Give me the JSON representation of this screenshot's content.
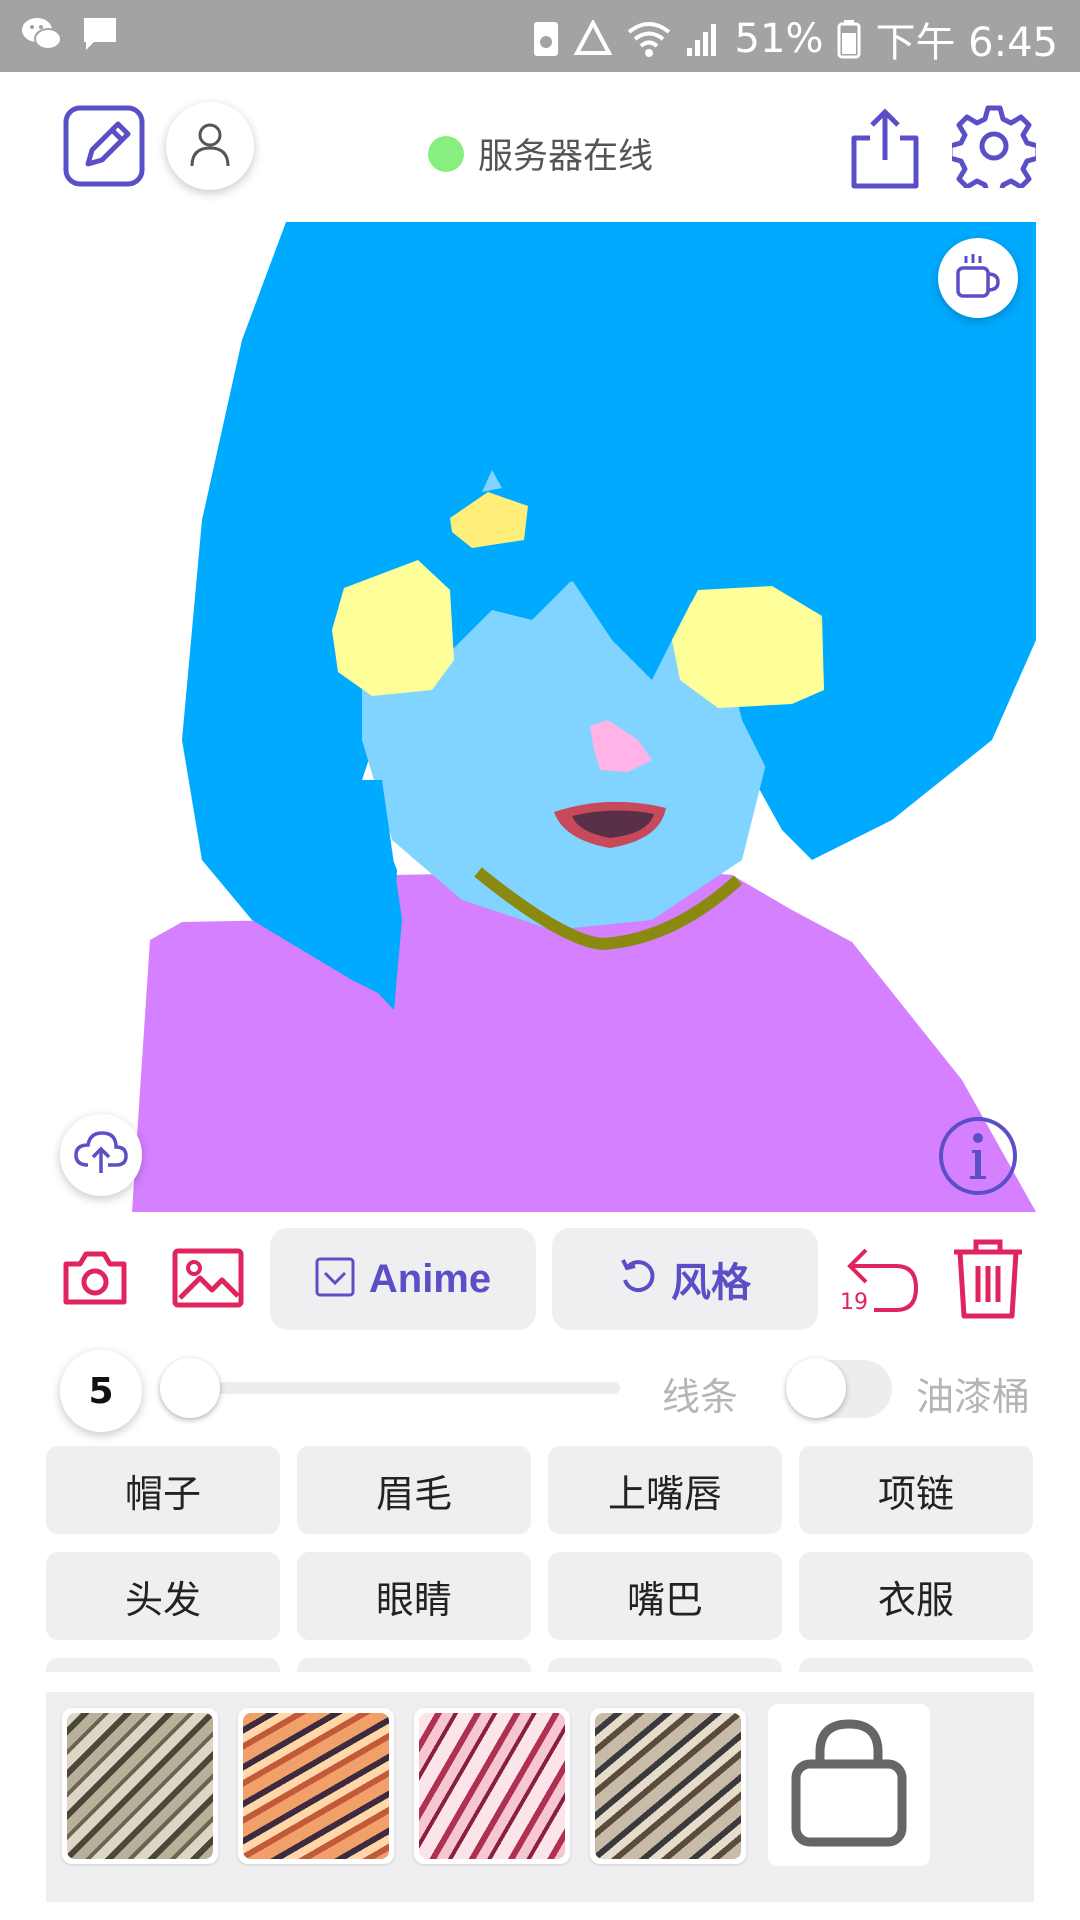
{
  "status_bar": {
    "battery": "51%",
    "time": "下午 6:45"
  },
  "header": {
    "server_status": "服务器在线",
    "server_status_color": "#86ef7d",
    "icons": [
      "edit-icon",
      "user-icon",
      "share-icon",
      "settings-icon"
    ]
  },
  "canvas": {
    "overlay_icons": [
      "coffee-icon",
      "cloud-upload-icon",
      "info-icon"
    ]
  },
  "toolbar": {
    "model_label": "Anime",
    "style_label": "风格",
    "undo_count": "19",
    "accent_color": "#5b4fc7",
    "danger_color": "#e0245e"
  },
  "brush": {
    "size": "5",
    "size_fraction": 0.0,
    "lines_label": "线条",
    "bucket_label": "油漆桶",
    "bucket_enabled": false
  },
  "categories": [
    "帽子",
    "眉毛",
    "上嘴唇",
    "项链",
    "头发",
    "眼睛",
    "嘴巴",
    "衣服"
  ],
  "textures": {
    "count": 4,
    "store_icon": "shopping-bag-icon"
  }
}
